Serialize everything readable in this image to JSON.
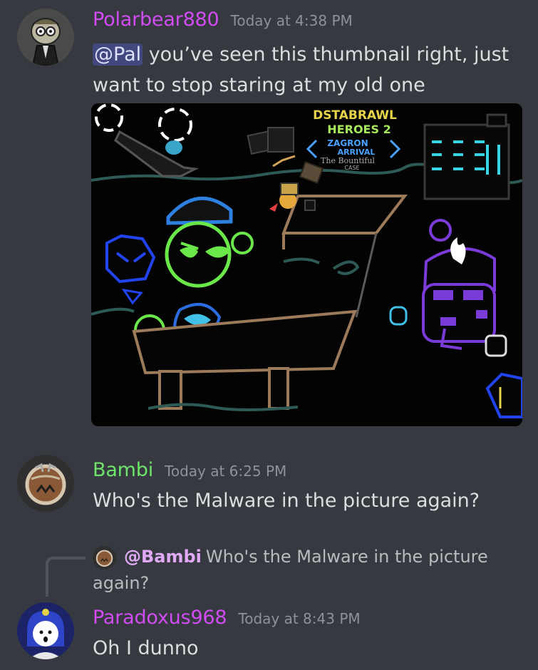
{
  "messages": [
    {
      "username": "Polarbear880",
      "username_color": "#d14cf2",
      "timestamp": "Today at 4:38 PM",
      "mention": "@Pal",
      "text": " you’ve seen this thumbnail right, just want to stop staring at my old one",
      "attachment": {
        "title_lines": [
          "DSTABRAWL",
          "HEROES 2",
          "ZAGRON",
          "ARRIVAL",
          "The Bountiful",
          "CASE"
        ]
      }
    },
    {
      "username": "Bambi",
      "username_color": "#6ee46b",
      "timestamp": "Today at 6:25 PM",
      "text": "Who's the Malware in the picture again?"
    },
    {
      "reply": {
        "mention": "@Bambi",
        "text": "Who's the Malware in the picture again?"
      },
      "username": "Paradoxus968",
      "username_color": "#d14cf2",
      "timestamp": "Today at 8:43 PM",
      "text": "Oh I dunno"
    }
  ]
}
